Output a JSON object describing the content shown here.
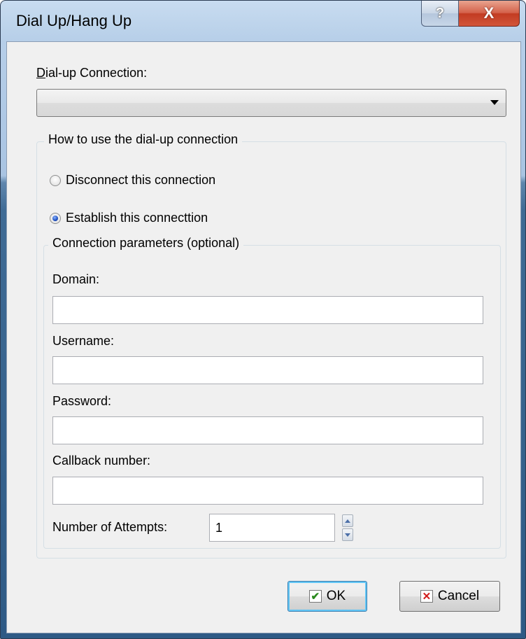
{
  "window": {
    "title": "Dial Up/Hang Up"
  },
  "titlebar": {
    "help_glyph": "?",
    "close_glyph": "X"
  },
  "connection": {
    "label": "Dial-up Connection:",
    "selected": ""
  },
  "usage": {
    "legend": "How to use the dial-up connection",
    "options": [
      {
        "label": "Disconnect this connection",
        "selected": false
      },
      {
        "label": "Establish this connecttion",
        "selected": true
      }
    ]
  },
  "params": {
    "legend": "Connection parameters (optional)",
    "fields": [
      {
        "label": "Domain:",
        "value": ""
      },
      {
        "label": "Username:",
        "value": ""
      },
      {
        "label": "Password:",
        "value": ""
      },
      {
        "label": "Callback number:",
        "value": ""
      }
    ],
    "attempts": {
      "label": "Number of Attempts:",
      "value": "1"
    }
  },
  "buttons": {
    "ok": "OK",
    "cancel": "Cancel"
  },
  "icons": {
    "ok": "checkmark-icon",
    "cancel": "x-icon",
    "combo": "chevron-down-icon"
  },
  "colors": {
    "title_bar": "#b6cee8",
    "client": "#f0f0f0",
    "close_button": "#c23b22",
    "default_button_glow": "#62c6f5"
  }
}
